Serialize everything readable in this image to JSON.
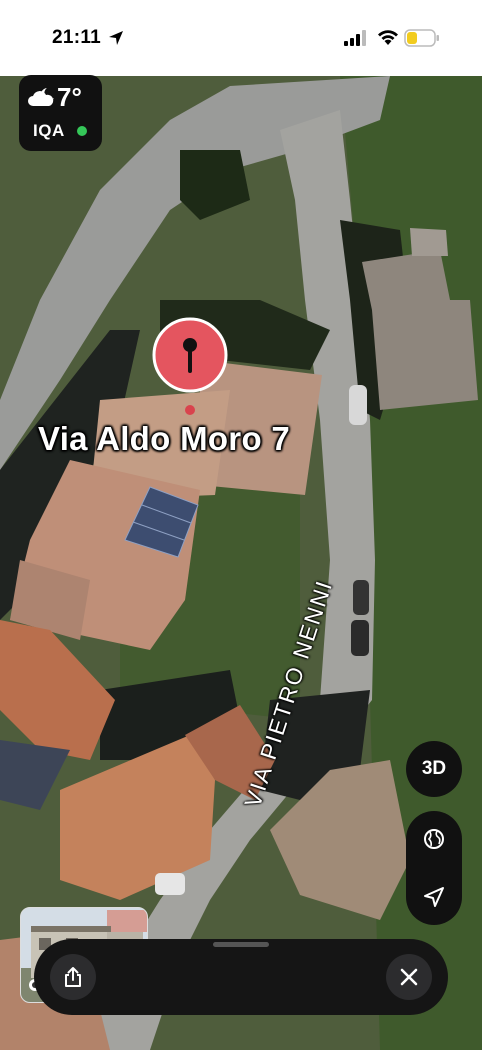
{
  "status_bar": {
    "time": "21:11"
  },
  "weather": {
    "temperature": "7°",
    "air_quality_label": "IQA",
    "air_quality_status_color": "#35c759"
  },
  "map": {
    "place_label": "Via Aldo Moro 7",
    "street_label": "VIA PIETRO NENNI",
    "pin_color": "#e4555f"
  },
  "controls": {
    "view_3d_label": "3D",
    "globe_icon": "globe-icon",
    "location_icon": "location-arrow-icon",
    "look_around_icon": "binoculars-icon"
  },
  "bottom_sheet": {
    "share_icon": "share-icon",
    "close_icon": "close-icon"
  }
}
